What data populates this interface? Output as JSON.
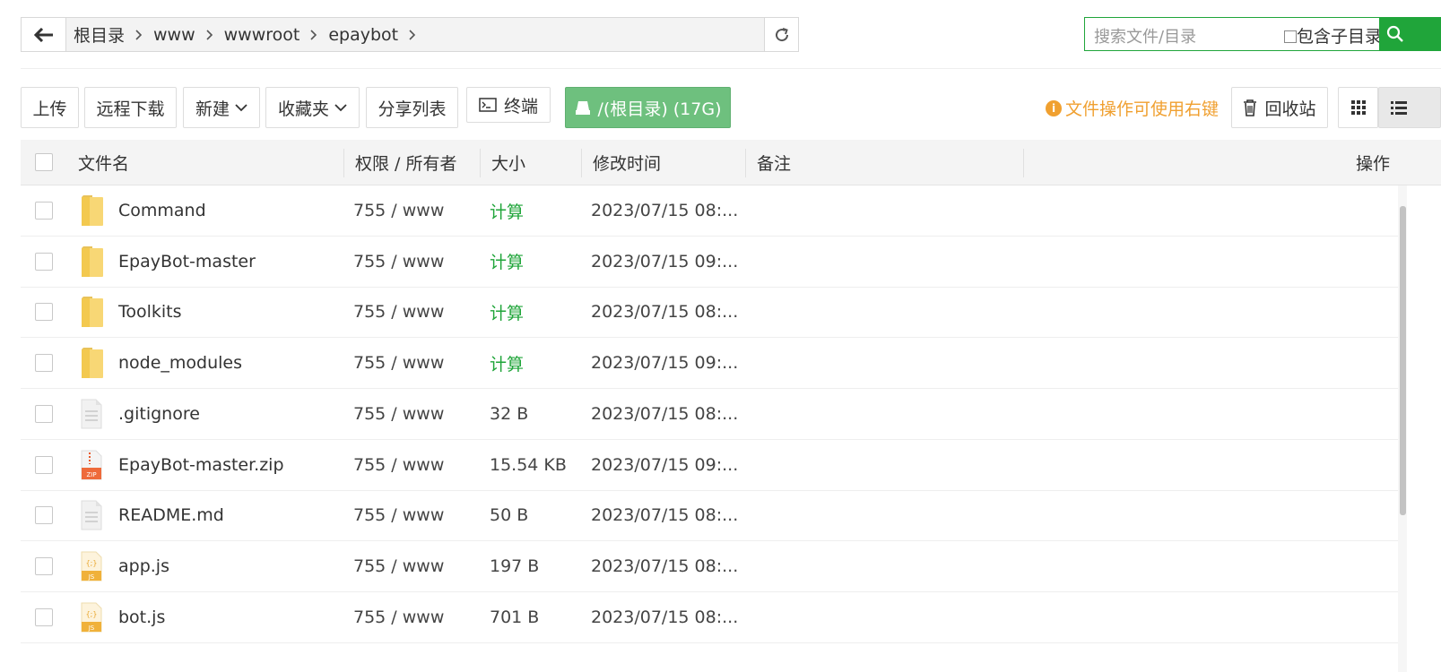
{
  "breadcrumb": {
    "items": [
      "根目录",
      "www",
      "wwwroot",
      "epaybot"
    ]
  },
  "search": {
    "placeholder": "搜索文件/目录",
    "include_sub_label": "包含子目录"
  },
  "toolbar": {
    "upload": "上传",
    "remote_download": "远程下载",
    "new": "新建",
    "favorites": "收藏夹",
    "share_list": "分享列表",
    "terminal": "终端",
    "disk": "/(根目录) (17G)",
    "tip": "文件操作可使用右键",
    "recycle": "回收站"
  },
  "table": {
    "headers": {
      "name": "文件名",
      "perm": "权限 / 所有者",
      "size": "大小",
      "mtime": "修改时间",
      "note": "备注",
      "ops": "操作"
    },
    "rows": [
      {
        "name": "Command",
        "type": "folder",
        "perm": "755 / www",
        "size": "计算",
        "mtime": "2023/07/15 08:..."
      },
      {
        "name": "EpayBot-master",
        "type": "folder",
        "perm": "755 / www",
        "size": "计算",
        "mtime": "2023/07/15 09:..."
      },
      {
        "name": "Toolkits",
        "type": "folder",
        "perm": "755 / www",
        "size": "计算",
        "mtime": "2023/07/15 08:..."
      },
      {
        "name": "node_modules",
        "type": "folder",
        "perm": "755 / www",
        "size": "计算",
        "mtime": "2023/07/15 09:..."
      },
      {
        "name": ".gitignore",
        "type": "text",
        "perm": "755 / www",
        "size": "32 B",
        "mtime": "2023/07/15 08:..."
      },
      {
        "name": "EpayBot-master.zip",
        "type": "zip",
        "perm": "755 / www",
        "size": "15.54 KB",
        "mtime": "2023/07/15 09:..."
      },
      {
        "name": "README.md",
        "type": "text",
        "perm": "755 / www",
        "size": "50 B",
        "mtime": "2023/07/15 08:..."
      },
      {
        "name": "app.js",
        "type": "js",
        "perm": "755 / www",
        "size": "197 B",
        "mtime": "2023/07/15 08:..."
      },
      {
        "name": "bot.js",
        "type": "js",
        "perm": "755 / www",
        "size": "701 B",
        "mtime": "2023/07/15 08:..."
      }
    ]
  },
  "icons": {
    "zip_badge": "ZIP",
    "js_badge": "JS",
    "js_braces": "{;}"
  },
  "colors": {
    "accent": "#20a53a",
    "disk_button": "#6ec07e",
    "tip": "#f0a030",
    "folder": "#f8d775"
  }
}
